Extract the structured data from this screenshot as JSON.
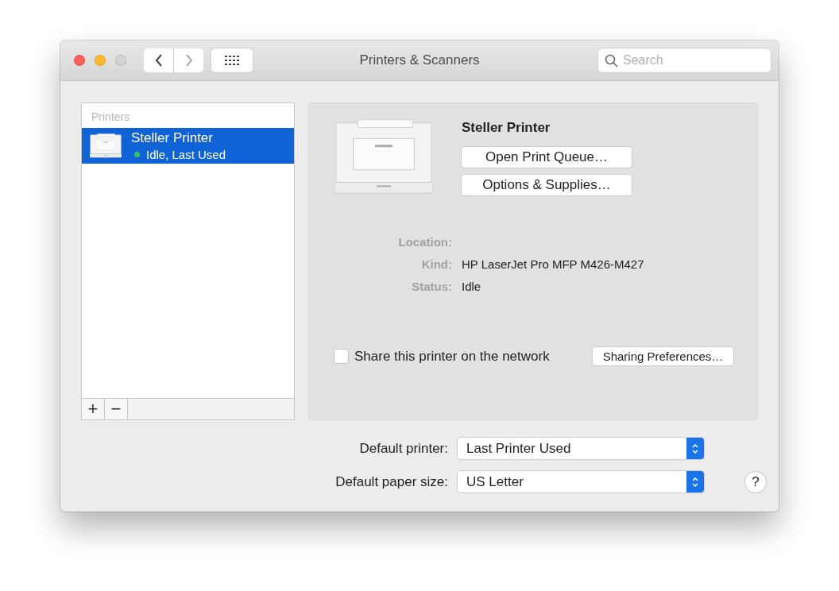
{
  "window": {
    "title": "Printers & Scanners"
  },
  "toolbar": {
    "search": {
      "placeholder": "Search"
    }
  },
  "printers": {
    "header": "Printers",
    "add": "+",
    "remove": "−",
    "items": [
      {
        "name": "Steller Printer",
        "status": "Idle, Last Used",
        "color": "#34c759",
        "selected": true
      }
    ]
  },
  "detail": {
    "name": "Steller Printer",
    "buttons": [
      "Open Print Queue…",
      "Options & Supplies…"
    ],
    "info": [
      {
        "label": "Location:"
      },
      {
        "label": "Kind:",
        "value": "HP LaserJet Pro MFP M426-M427"
      },
      {
        "label": "Status:",
        "value": "Idle"
      }
    ],
    "share": {
      "label": "Share this printer on the network",
      "checked": false
    },
    "sharing_button": "Sharing Preferences…"
  },
  "defaults": [
    {
      "label": "Default printer:",
      "value": "Last Printer Used"
    },
    {
      "label": "Default paper size:",
      "value": "US Letter"
    }
  ],
  "help": "?"
}
